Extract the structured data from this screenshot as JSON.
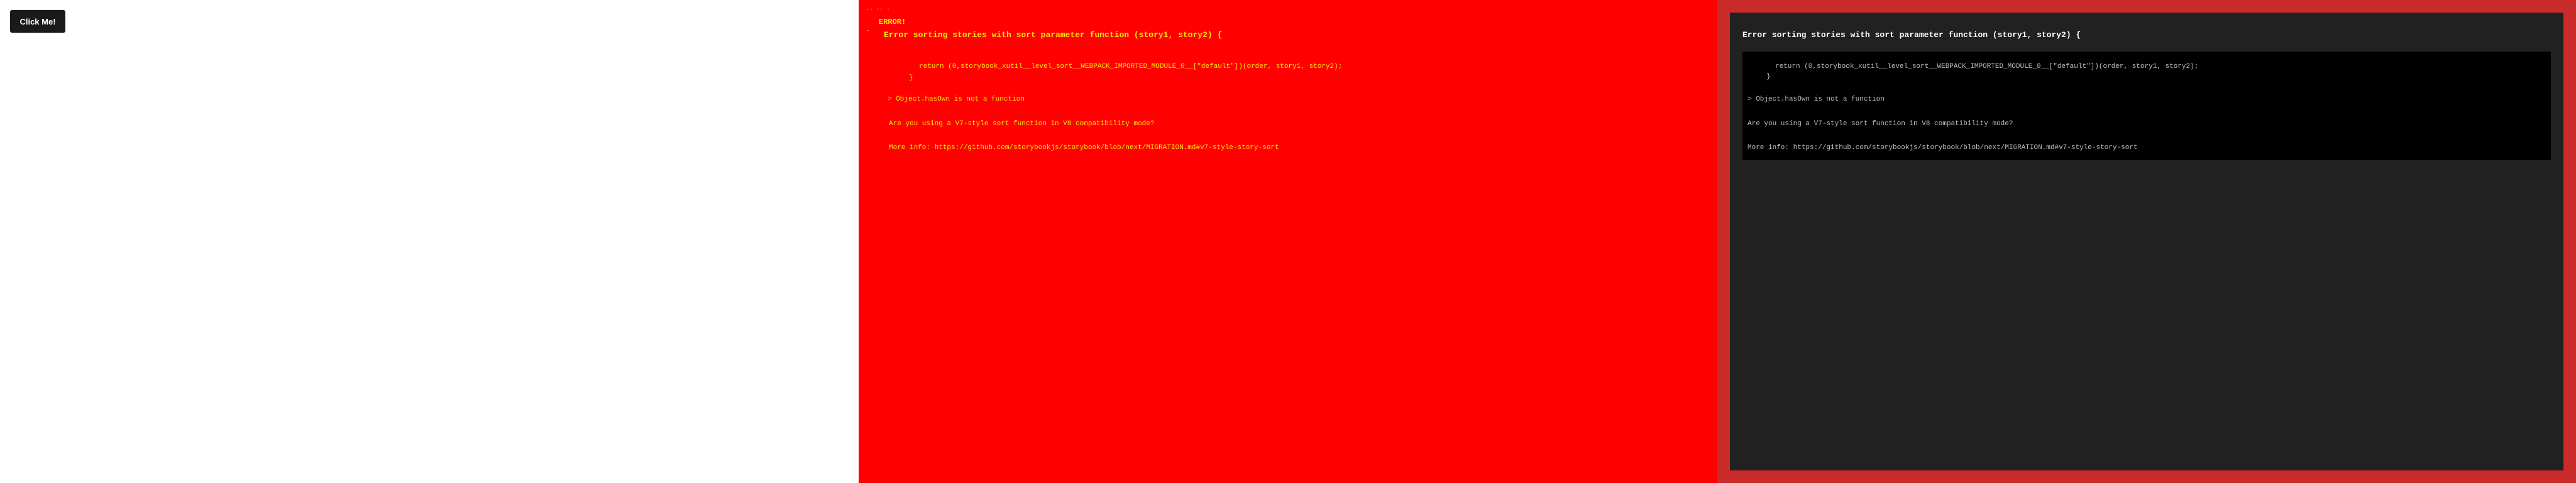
{
  "preview": {
    "button_label": "Click Me!"
  },
  "red_overlay": {
    "markers": [
      "--  --  -",
      "-"
    ],
    "title": "ERROR!",
    "heading": "Error sorting stories with sort parameter function (story1, story2) {",
    "code_line_1": "return (0,storybook_xutil__level_sort__WEBPACK_IMPORTED_MODULE_0__[\"default\"])(order, story1, story2);",
    "code_line_2": "}",
    "error_line": "> Object.hasOwn is not a function",
    "question_line": "Are you using a V7-style sort function in V8 compatibility mode?",
    "info_line": "More info: https://github.com/storybookjs/storybook/blob/next/MIGRATION.md#v7-style-story-sort"
  },
  "dark_overlay": {
    "heading": "Error sorting stories with sort parameter function (story1, story2) {",
    "code_line_1": "return (0,storybook_xutil__level_sort__WEBPACK_IMPORTED_MODULE_0__[\"default\"])(order, story1, story2);",
    "code_line_2": "}",
    "error_line": "> Object.hasOwn is not a function",
    "question_line": "Are you using a V7-style sort function in V8 compatibility mode?",
    "info_line": "More info: https://github.com/storybookjs/storybook/blob/next/MIGRATION.md#v7-style-story-sort"
  },
  "colors": {
    "red_bg": "#ff0000",
    "red_text": "#ffe600",
    "dark_outer": "#c92a2a",
    "dark_inner": "#212121",
    "dark_code_bg": "#000000"
  }
}
